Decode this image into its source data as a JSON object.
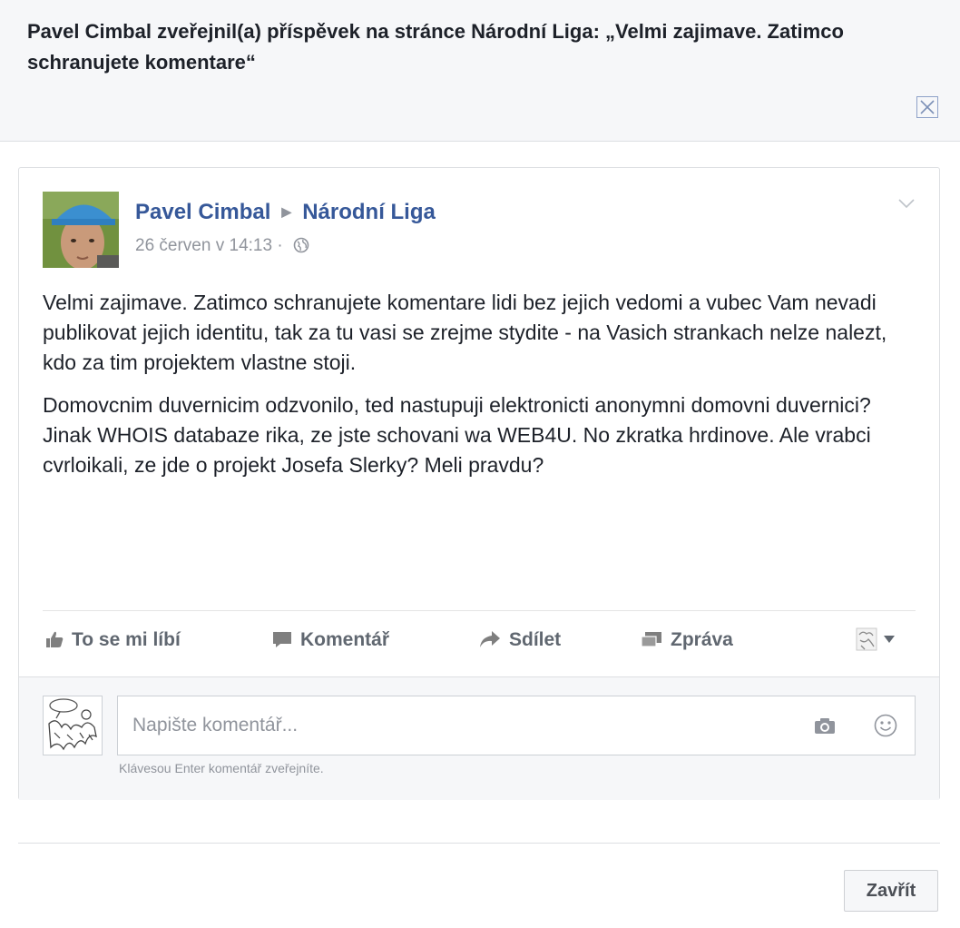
{
  "dialog": {
    "title": "Pavel Cimbal zveřejnil(a) příspěvek na stránce Národní Liga: „Velmi zajimave. Zatimco schranujete komentare“",
    "close_button_label": "Zavřít"
  },
  "post": {
    "author": "Pavel Cimbal",
    "target_page": "Národní Liga",
    "timestamp": "26 červen v 14:13",
    "separator": "·",
    "paragraphs": [
      "Velmi zajimave. Zatimco schranujete komentare lidi bez jejich vedomi a vubec Vam nevadi publikovat jejich identitu, tak za tu vasi se zrejme stydite - na Vasich strankach nelze nalezt, kdo za tim projektem vlastne stoji.",
      "Domovcnim duvernicim odzvonilo, ted nastupuji elektronicti anonymni domovni duvernici? Jinak WHOIS databaze rika, ze jste schovani wa WEB4U. No zkratka hrdinove. Ale vrabci cvrloikali, ze jde o projekt Josefa Slerky? Meli pravdu?"
    ]
  },
  "actions": {
    "like": "To se mi líbí",
    "comment": "Komentář",
    "share": "Sdílet",
    "message": "Zpráva"
  },
  "comment": {
    "placeholder": "Napište komentář...",
    "hint": "Klávesou Enter komentář zveřejníte."
  },
  "colors": {
    "link": "#365899",
    "header_bg": "#f6f7f9",
    "muted": "#90949c"
  }
}
